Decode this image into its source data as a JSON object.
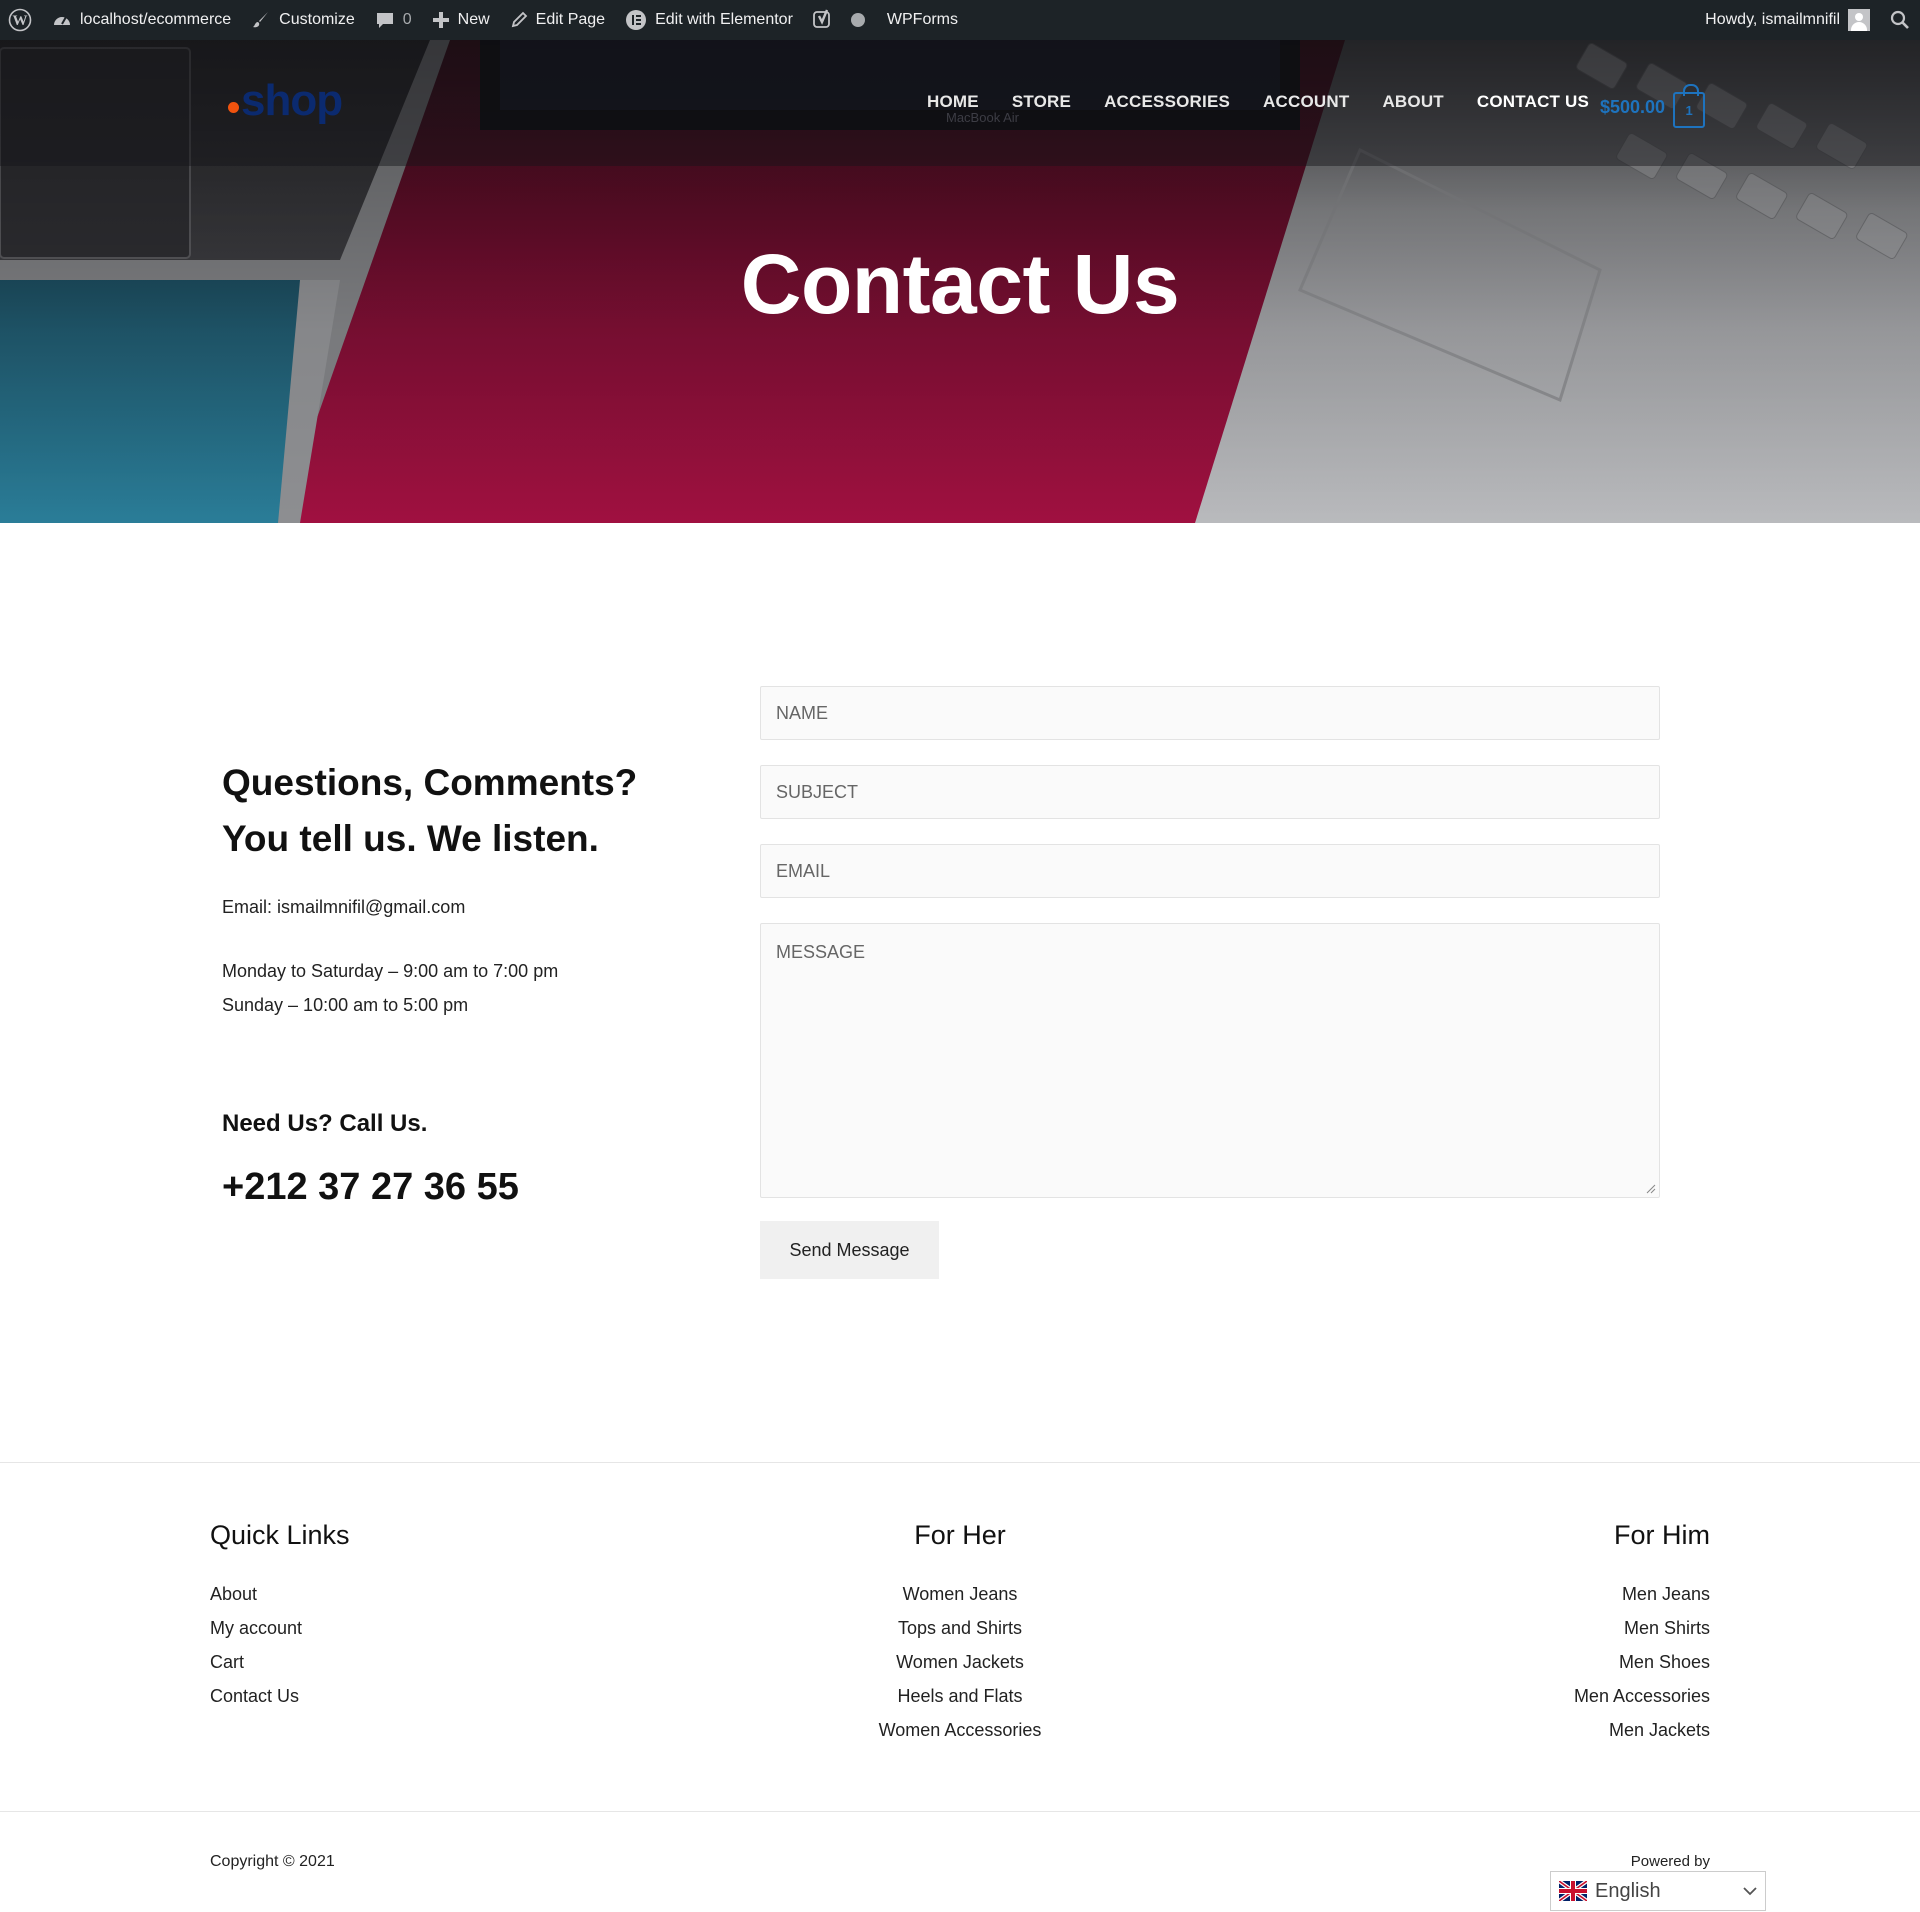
{
  "adminbar": {
    "site": "localhost/ecommerce",
    "customize": "Customize",
    "comments_count": "0",
    "new": "New",
    "edit_page": "Edit Page",
    "edit_elementor": "Edit with Elementor",
    "wpforms": "WPForms",
    "howdy": "Howdy, ismailmnifil"
  },
  "header": {
    "logo_text": "shop",
    "nav": [
      "HOME",
      "STORE",
      "ACCESSORIES",
      "ACCOUNT",
      "ABOUT",
      "CONTACT US"
    ],
    "active_nav": "CONTACT US",
    "cart_total": "$500.00",
    "cart_count": "1"
  },
  "hero": {
    "title": "Contact Us",
    "macbook_label": "MacBook Air"
  },
  "contact": {
    "heading": "Questions, Comments? You tell us. We listen.",
    "email": "Email: ismailmnifil@gmail.com",
    "hours_weekdays": "Monday to Saturday – 9:00 am to 7:00 pm",
    "hours_sunday": "Sunday – 10:00 am to 5:00 pm",
    "call_heading": "Need Us? Call Us.",
    "phone": "+212 37 27 36 55"
  },
  "form": {
    "name_placeholder": "NAME",
    "subject_placeholder": "SUBJECT",
    "email_placeholder": "EMAIL",
    "message_placeholder": "MESSAGE",
    "submit_label": "Send Message"
  },
  "footer": {
    "quick_links": {
      "title": "Quick Links",
      "items": [
        "About",
        "My account",
        "Cart",
        "Contact Us"
      ]
    },
    "for_her": {
      "title": "For Her",
      "items": [
        "Women Jeans",
        "Tops and Shirts",
        "Women Jackets",
        "Heels and Flats",
        "Women Accessories"
      ]
    },
    "for_him": {
      "title": "For Him",
      "items": [
        "Men Jeans",
        "Men Shirts",
        "Men Shoes",
        "Men Accessories",
        "Men Jackets"
      ]
    },
    "copyright": "Copyright © 2021",
    "powered_by": "Powered by",
    "language": "English"
  },
  "colors": {
    "adminbar_bg": "#1d2327",
    "accent_blue": "#1e73be",
    "logo_blue": "#0b2a6f",
    "logo_dot": "#f0530e",
    "hero_crimson": "#a01040",
    "hero_teal": "#2aa6c8"
  }
}
